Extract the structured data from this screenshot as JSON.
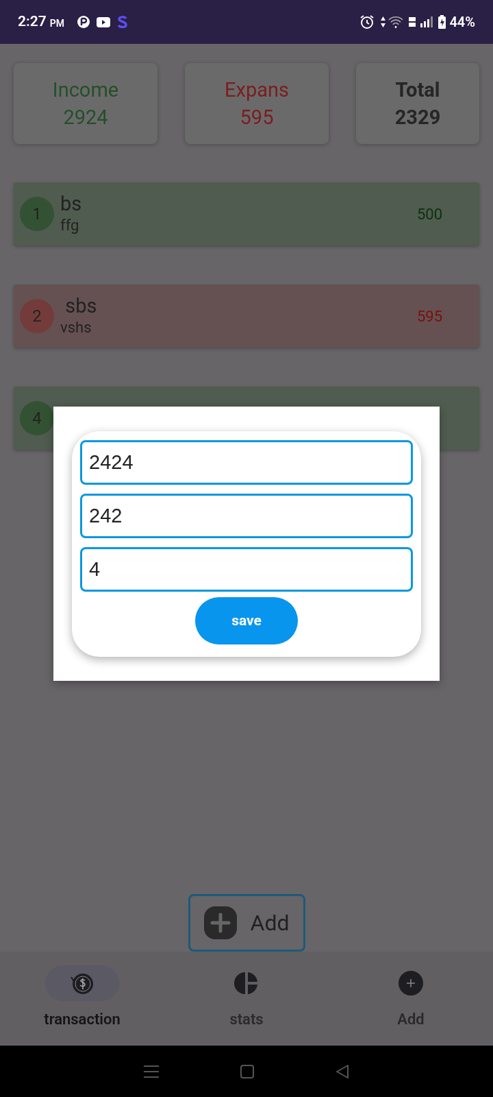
{
  "status_bar": {
    "time": "2:27",
    "ampm": "PM",
    "battery": "44%"
  },
  "summary": [
    {
      "label": "Income",
      "value": "2924",
      "kind": "income"
    },
    {
      "label": "Expans",
      "value": "595",
      "kind": "expense"
    },
    {
      "label": "Total",
      "value": "2329",
      "kind": "total"
    }
  ],
  "transactions": [
    {
      "number": "1",
      "title": "bs",
      "note": "ffg",
      "amount": "500",
      "kind": "income"
    },
    {
      "number": "2",
      "title": " sbs",
      "note": "vshs",
      "amount": "595",
      "kind": "expense"
    },
    {
      "number": "4",
      "kind": "income"
    }
  ],
  "dialog": {
    "fields": [
      {
        "value": "2424"
      },
      {
        "value": "242"
      },
      {
        "value": "4"
      }
    ],
    "button": "save"
  },
  "add_button": "Add",
  "nav": [
    {
      "label": "transaction",
      "selected": true,
      "kind": "transaction"
    },
    {
      "label": "stats",
      "selected": false,
      "kind": "stats"
    },
    {
      "label": "Add",
      "selected": false,
      "kind": "add"
    }
  ]
}
